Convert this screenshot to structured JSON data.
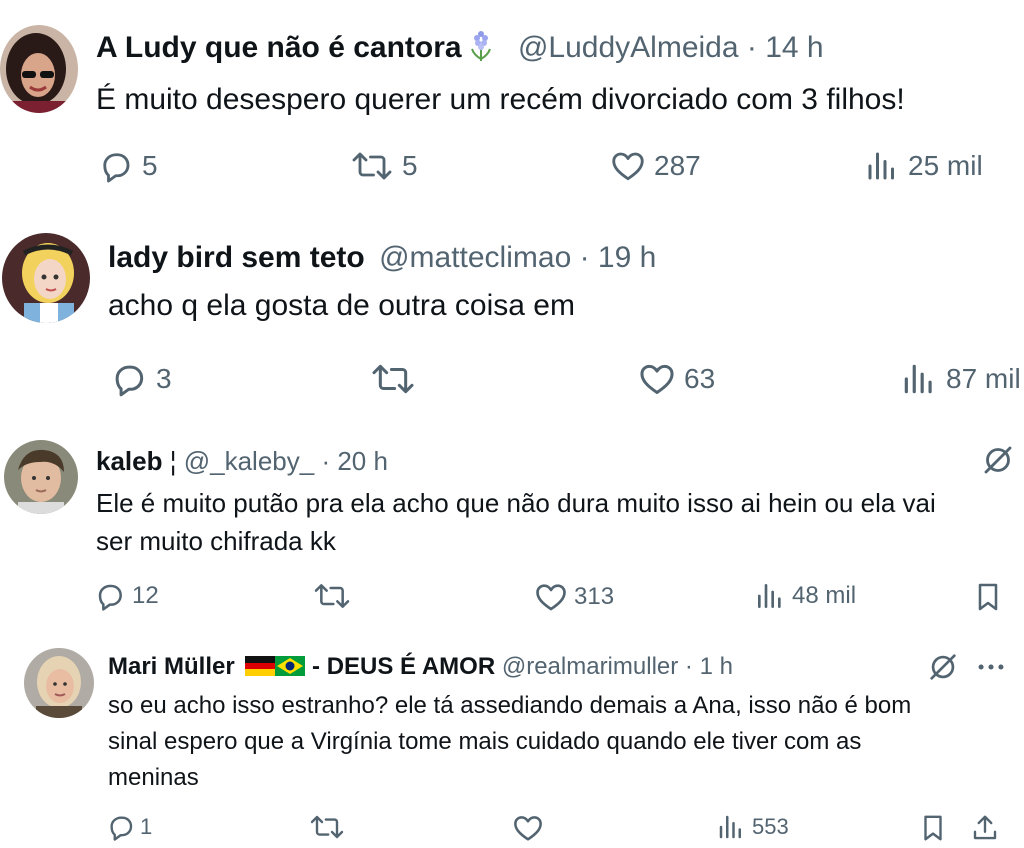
{
  "tweets": [
    {
      "name": "A Ludy que não é cantora",
      "name_emoji": "flower-emoji",
      "handle": "@LuddyAlmeida",
      "time": "· 14 h",
      "text": "É muito desespero querer um recém divorciado com 3 filhos!",
      "replies": "5",
      "retweets": "5",
      "likes": "287",
      "views": "25 mil"
    },
    {
      "name": "lady bird sem teto",
      "handle": "@matteclimao",
      "time": "· 19 h",
      "text": "acho q ela gosta de outra coisa em",
      "replies": "3",
      "retweets": "",
      "likes": "63",
      "views": "87 mil"
    },
    {
      "name": "kaleb",
      "name_suffix": "¦",
      "handle": "@_kaleby_",
      "time": "· 20 h",
      "text_line1": "Ele é muito putão pra ela  acho que não dura muito isso ai hein ou ela vai",
      "text_line2": "ser muito chifrada kk",
      "replies": "12",
      "retweets": "",
      "likes": "313",
      "views": "48 mil"
    },
    {
      "name": "Mari Müller",
      "flags": [
        "germany-flag",
        "brazil-flag"
      ],
      "name_suffix": "- DEUS É AMOR",
      "handle": "@realmarimuller",
      "time": "· 1 h",
      "text_line1": "so eu acho isso estranho? ele tá assediando demais a Ana, isso não é bom",
      "text_line2": "sinal espero que a Virgínia tome mais cuidado quando ele tiver com as",
      "text_line3": "meninas",
      "replies": "1",
      "retweets": "",
      "likes": "",
      "views": "553"
    }
  ],
  "colors": {
    "text": "#0f1419",
    "secondary": "#536471",
    "background": "#ffffff"
  }
}
